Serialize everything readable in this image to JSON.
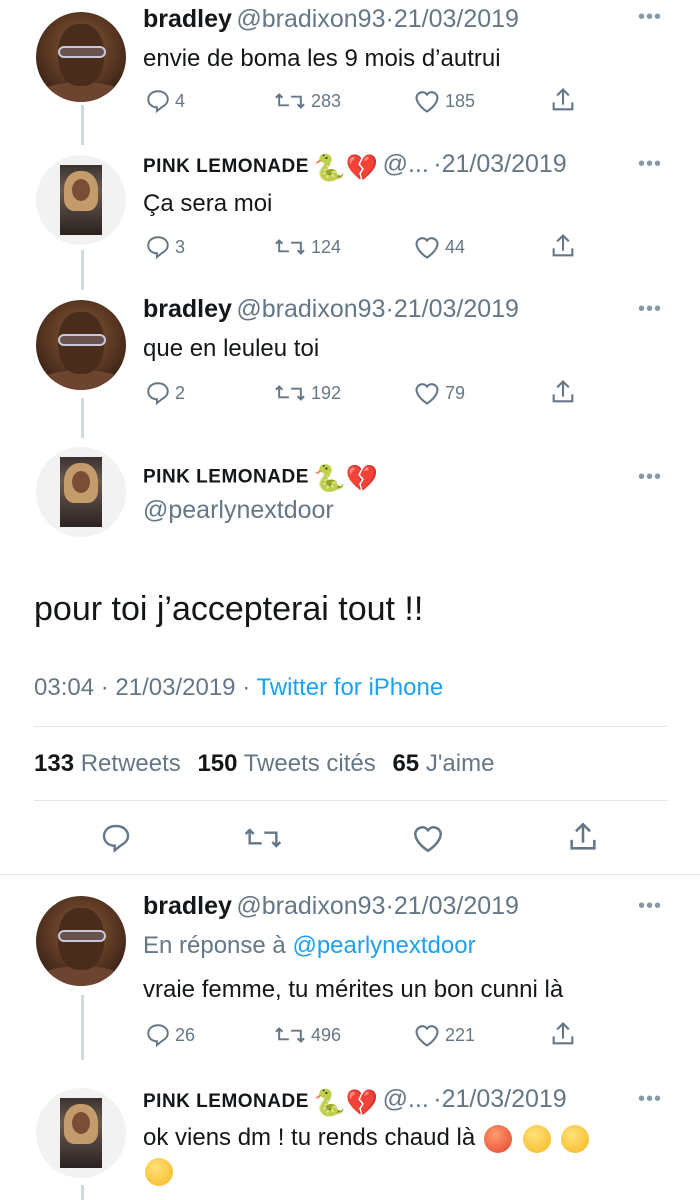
{
  "tweets": [
    {
      "name": "bradley",
      "handle": "@bradixon93",
      "sep": "·",
      "date": "21/03/2019",
      "text": "envie de boma les 9 mois d’autrui",
      "replies": "4",
      "retweets": "283",
      "likes": "185"
    },
    {
      "name": "PINK LEMONADE",
      "handle": "@...",
      "sep": "·",
      "date": "21/03/2019",
      "text": "Ça sera moi",
      "replies": "3",
      "retweets": "124",
      "likes": "44"
    },
    {
      "name": "bradley",
      "handle": "@bradixon93",
      "sep": "·",
      "date": "21/03/2019",
      "text": "que en leuleu toi",
      "replies": "2",
      "retweets": "192",
      "likes": "79"
    }
  ],
  "main": {
    "name": "PINK LEMONADE",
    "handle": "@pearlynextdoor",
    "text": "pour toi j’accepterai tout !!",
    "time": "03:04",
    "sep1": "·",
    "date": "21/03/2019",
    "sep2": "·",
    "source": "Twitter for iPhone",
    "retweets_count": "133",
    "retweets_label": "Retweets",
    "quotes_count": "150",
    "quotes_label": "Tweets cités",
    "likes_count": "65",
    "likes_label": "J'aime"
  },
  "reply1": {
    "name": "bradley",
    "handle": "@bradixon93",
    "sep": "·",
    "date": "21/03/2019",
    "in_reply_prefix": "En réponse à",
    "in_reply_handle": "@pearlynextdoor",
    "text": "vraie femme, tu mérites un bon cunni là",
    "replies": "26",
    "retweets": "496",
    "likes": "221"
  },
  "reply2": {
    "name": "PINK LEMONADE",
    "handle": "@...",
    "sep": "·",
    "date": "21/03/2019",
    "text": "ok viens dm ! tu rends chaud là"
  },
  "colors": {
    "accent": "#1da1f2",
    "muted": "#657786",
    "heart_emoji": "#c21e2f"
  }
}
